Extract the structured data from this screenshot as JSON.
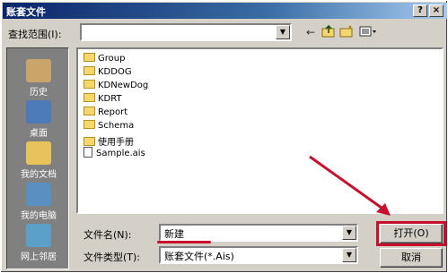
{
  "window": {
    "title": "账套文件",
    "help_label": "?",
    "close_label": "×"
  },
  "look_in": {
    "label": "查找范围(I):",
    "value": ""
  },
  "toolbar": {
    "back_icon": "←",
    "up_icon": "up-folder-icon",
    "new_folder_icon": "new-folder-icon",
    "view_icon": "view-menu-icon"
  },
  "places": [
    {
      "label": "历史",
      "icon": "history-icon",
      "color": "#c9a46b"
    },
    {
      "label": "桌面",
      "icon": "desktop-icon",
      "color": "#4d7ab8"
    },
    {
      "label": "我的文档",
      "icon": "my-documents-icon",
      "color": "#e8c25a"
    },
    {
      "label": "我的电脑",
      "icon": "my-computer-icon",
      "color": "#5a8fc2"
    },
    {
      "label": "网上邻居",
      "icon": "network-icon",
      "color": "#5aa0c9"
    }
  ],
  "files": [
    {
      "name": "Group",
      "type": "folder"
    },
    {
      "name": "KDDOG",
      "type": "folder"
    },
    {
      "name": "KDNewDog",
      "type": "folder"
    },
    {
      "name": "KDRT",
      "type": "folder"
    },
    {
      "name": "Report",
      "type": "folder"
    },
    {
      "name": "Schema",
      "type": "folder"
    },
    {
      "name": "使用手册",
      "type": "folder"
    },
    {
      "name": "Sample.ais",
      "type": "file"
    }
  ],
  "filename": {
    "label": "文件名(N):",
    "value": "新建"
  },
  "filetype": {
    "label": "文件类型(T):",
    "value": "账套文件(*.Ais)"
  },
  "buttons": {
    "open": "打开(O)",
    "cancel": "取消"
  },
  "annotation_color": "#c8102e"
}
